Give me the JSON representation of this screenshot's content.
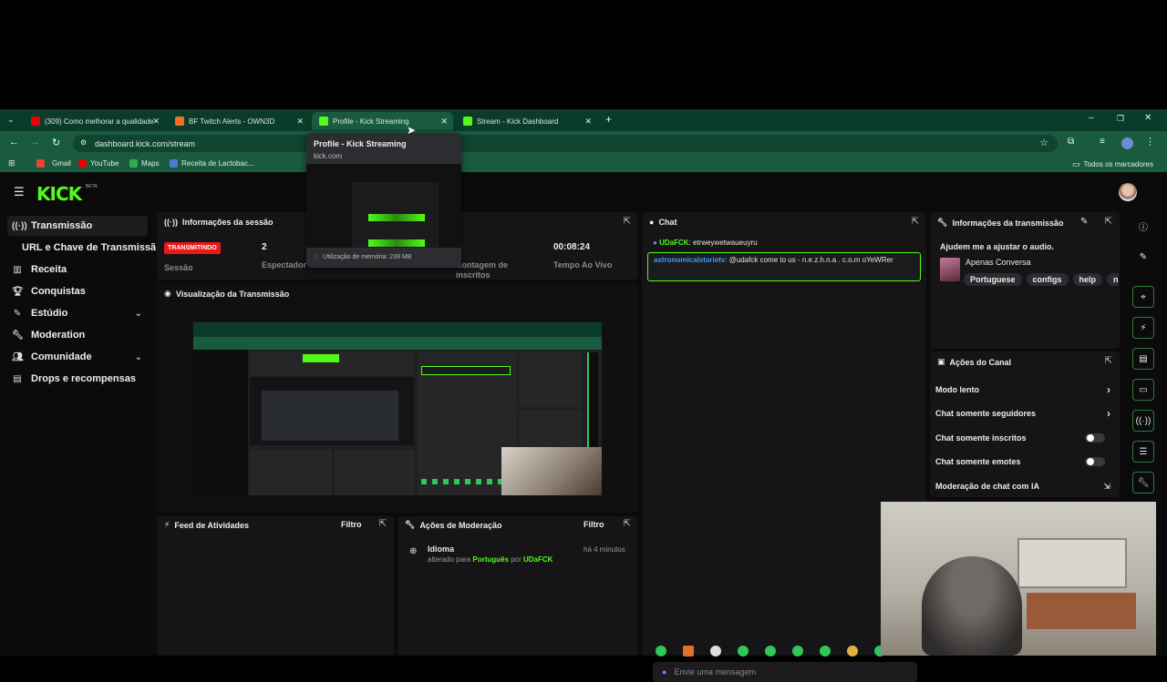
{
  "browser": {
    "tabs": [
      {
        "title": "(309) Como melhorar a qualidade",
        "favicon": "youtube-icon"
      },
      {
        "title": "BF Twitch Alerts - OWN3D",
        "favicon": "own3d-icon"
      },
      {
        "title": "Profile - Kick Streaming",
        "favicon": "kick-icon"
      },
      {
        "title": "Stream - Kick Dashboard",
        "favicon": "kick-icon"
      }
    ],
    "url": "dashboard.kick.com/stream",
    "bookmarks": [
      {
        "label": "Gmail"
      },
      {
        "label": "YouTube"
      },
      {
        "label": "Maps"
      },
      {
        "label": "Receita de Lactobac..."
      }
    ],
    "all_bookmarks": "Todos os marcadores",
    "tab_tooltip": {
      "title": "Profile - Kick Streaming",
      "domain": "kick.com",
      "memory": "Utilização de memória: 239 MB"
    }
  },
  "app": {
    "logo": "KICK",
    "beta": "BETA",
    "sidebar": [
      {
        "label": "Transmissão",
        "icon": "broadcast-icon"
      },
      {
        "label": "URL e Chave de Transmissão",
        "icon": ""
      },
      {
        "label": "Receita",
        "icon": "chart-icon"
      },
      {
        "label": "Conquistas",
        "icon": "trophy-icon"
      },
      {
        "label": "Estúdio",
        "icon": "pencil-icon"
      },
      {
        "label": "Moderation",
        "icon": "wrench-icon"
      },
      {
        "label": "Comunidade",
        "icon": "people-icon"
      },
      {
        "label": "Drops e recompensas",
        "icon": "drops-icon"
      }
    ],
    "session": {
      "title": "Informações da sessão",
      "status": "TRANSMITINDO",
      "status_label": "Sessão",
      "viewers": "2",
      "viewers_label": "Espectador",
      "subs_label": "Contagem de inscritos",
      "time": "00:08:24",
      "time_label": "Tempo Ao Vivo"
    },
    "preview": {
      "title": "Visualização da Transmissão"
    },
    "activity": {
      "title": "Feed de Atividades",
      "filter": "Filtro"
    },
    "mod_actions": {
      "title": "Ações de Moderação",
      "filter": "Filtro",
      "item_title": "Idioma",
      "item_prefix": "alterado para",
      "item_lang": "Português",
      "item_by": "por",
      "item_user": "UDaFCK",
      "item_time": "há 4 minutos"
    },
    "chat": {
      "title": "Chat",
      "messages": [
        {
          "user": "UDaFCK",
          "text": ": etrweywetwaueuyru"
        },
        {
          "user": "astronomicalstarietv",
          "text": ": @udafck come to us - n.e.z.h.n.a . c.o.m oYeWRer"
        }
      ],
      "placeholder": "Envie uma mensagem"
    },
    "stream_info": {
      "title": "Informações da transmissão",
      "stream_title": "Ajudem me a ajustar o audio.",
      "category": "Apenas Conversa",
      "tags": [
        "Portuguese",
        "configs",
        "help",
        "n"
      ]
    },
    "channel_actions": {
      "title": "Ações do Canal",
      "items": [
        {
          "label": "Modo lento",
          "control": "arrow"
        },
        {
          "label": "Chat somente seguidores",
          "control": "arrow"
        },
        {
          "label": "Chat somente inscritos",
          "control": "toggle"
        },
        {
          "label": "Chat somente emotes",
          "control": "toggle"
        },
        {
          "label": "Moderação de chat com IA",
          "control": "external"
        }
      ]
    }
  },
  "colors": {
    "accent": "#53fc18",
    "live": "#e91916",
    "tab_bg": "#0b3b2a"
  }
}
